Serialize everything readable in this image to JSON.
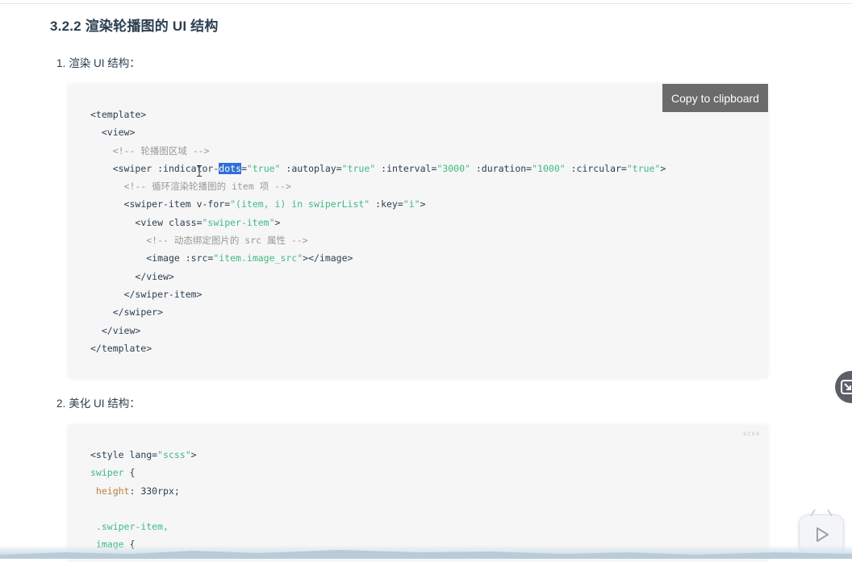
{
  "heading": "3.2.2 渲染轮播图的 UI 结构",
  "steps": [
    {
      "num": "1.",
      "label": "渲染 UI 结构："
    },
    {
      "num": "2.",
      "label": "美化 UI 结构："
    }
  ],
  "copy_button_label": "Copy to clipboard",
  "block2_lang": "scss",
  "code1": {
    "l1": {
      "tag": "<template>"
    },
    "l2": {
      "tag": "<view>"
    },
    "l3": {
      "cmt": "<!-- 轮播图区域 -->"
    },
    "l4": {
      "open": "<swiper",
      "a1_pre": ":indicator-",
      "a1_sel": "dots",
      "a1_eq": "=",
      "v1": "\"true\"",
      "a2": ":autoplay=",
      "v2": "\"true\"",
      "a3": ":interval=",
      "v3": "\"3000\"",
      "a4": ":duration=",
      "v4": "\"1000\"",
      "a5": ":circular=",
      "v5": "\"true\"",
      "close": ">"
    },
    "l5": {
      "cmt": "<!-- 循环渲染轮播图的 item 项 -->"
    },
    "l6": {
      "open": "<swiper-item",
      "a1": "v-for=",
      "v1": "\"(item, i) in swiperList\"",
      "a2": ":key=",
      "v2": "\"i\"",
      "close": ">"
    },
    "l7": {
      "open": "<view",
      "a1": "class=",
      "v1": "\"swiper-item\"",
      "close": ">"
    },
    "l8": {
      "cmt": "<!-- 动态绑定图片的 src 属性 -->"
    },
    "l9": {
      "open": "<image",
      "a1": ":src=",
      "v1": "\"item.image_src\"",
      "close": "></image>"
    },
    "l10": {
      "tag": "</view>"
    },
    "l11": {
      "tag": "</swiper-item>"
    },
    "l12": {
      "tag": "</swiper>"
    },
    "l13": {
      "tag": "</view>"
    },
    "l14": {
      "tag": "</template>"
    }
  },
  "code2": {
    "l1": {
      "open": "<style",
      "a1": "lang=",
      "v1": "\"scss\"",
      "close": ">"
    },
    "l2": {
      "sel": "swiper",
      "brace": "{"
    },
    "l3": {
      "prop": "height",
      "val": ": 330rpx;"
    },
    "l5": {
      "sel": ".swiper-item,"
    },
    "l6": {
      "sel": "image",
      "brace": "{"
    }
  }
}
